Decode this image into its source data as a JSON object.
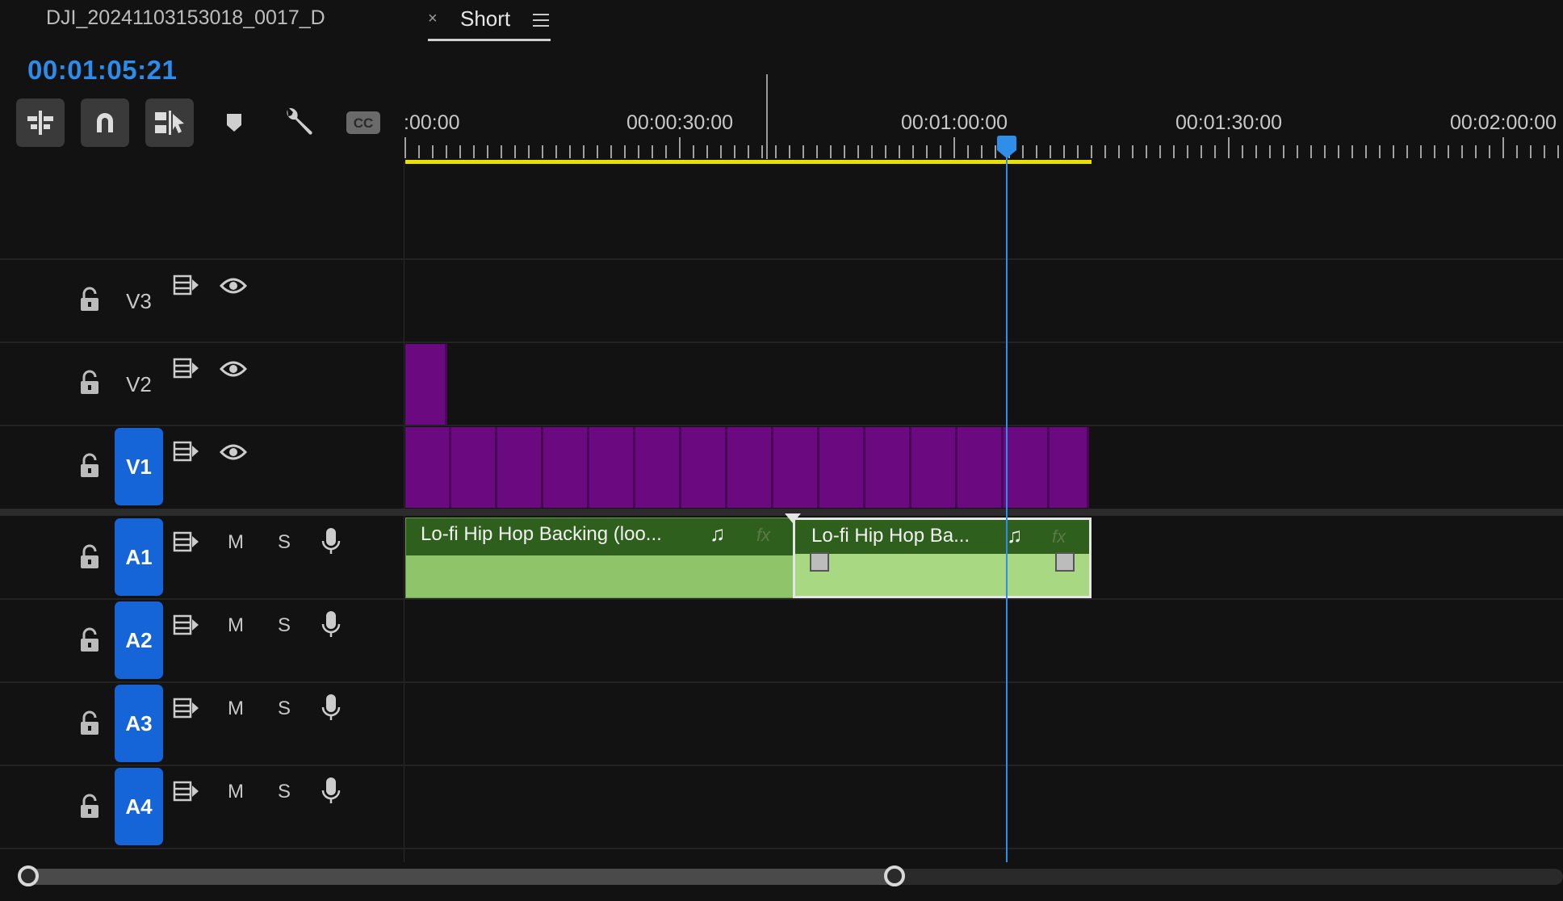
{
  "tabs": {
    "sequence_name": "DJI_20241103153018_0017_D",
    "close_glyph": "×",
    "active_tab": "Short"
  },
  "timecode": "00:01:05:21",
  "toolbar": [
    {
      "name": "insert-nest-icon",
      "active": true
    },
    {
      "name": "snap-magnet-icon",
      "active": true
    },
    {
      "name": "linked-selection-icon",
      "active": true
    },
    {
      "name": "add-marker-icon",
      "active": false
    },
    {
      "name": "timeline-settings-wrench-icon",
      "active": false
    },
    {
      "name": "captions-cc-icon",
      "active": false,
      "label": "CC"
    }
  ],
  "ruler": {
    "labels": [
      ":00:00",
      "00:00:30:00",
      "00:01:00:00",
      "00:01:30:00",
      "00:02:00:00"
    ]
  },
  "tracks": {
    "video": [
      {
        "name": "V3",
        "targeted": false
      },
      {
        "name": "V2",
        "targeted": false
      },
      {
        "name": "V1",
        "targeted": true
      }
    ],
    "audio": [
      {
        "name": "A1",
        "mute": "M",
        "solo": "S"
      },
      {
        "name": "A2",
        "mute": "M",
        "solo": "S"
      },
      {
        "name": "A3",
        "mute": "M",
        "solo": "S"
      },
      {
        "name": "A4",
        "mute": "M",
        "solo": "S"
      }
    ]
  },
  "clips": {
    "audio": [
      {
        "title": "Lo-fi Hip Hop Backing (loo...",
        "note": "♫",
        "fx": "fx"
      },
      {
        "title": "Lo-fi Hip Hop Ba...",
        "note": "♫",
        "fx": "fx"
      }
    ]
  },
  "colors": {
    "accent": "#2f8fe8",
    "work_area": "#e9e000",
    "video_clip": "#6b0a80",
    "audio_clip": "#2f5f1c",
    "waveform": "#8fc46b"
  }
}
